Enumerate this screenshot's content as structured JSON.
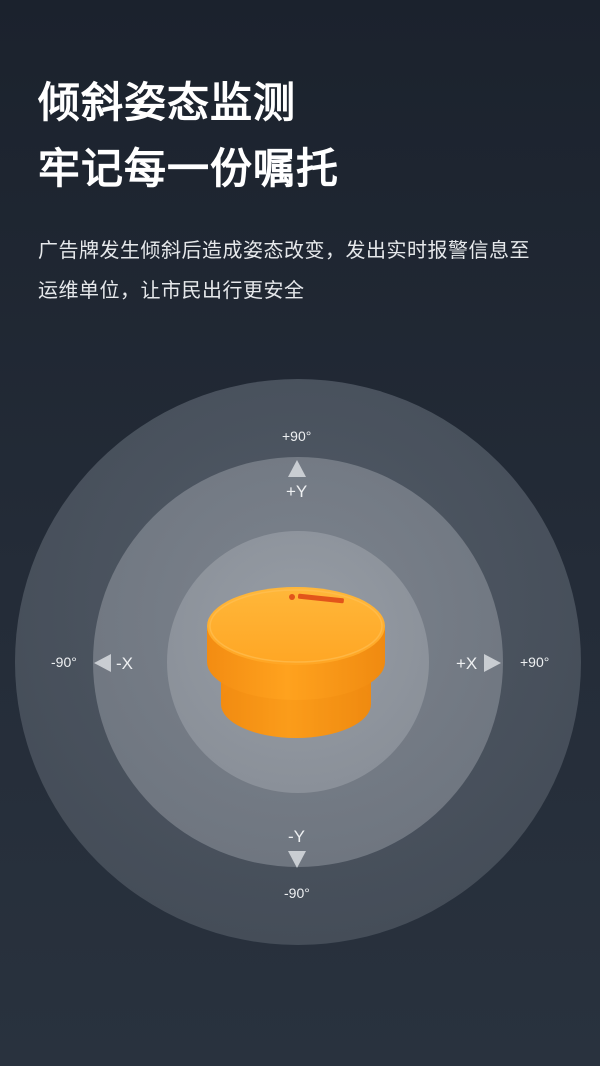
{
  "headline": {
    "line1": "倾斜姿态监测",
    "line2": "牢记每一份嘱托"
  },
  "description": {
    "line1": "广告牌发生倾斜后造成姿态改变，发出实时报警信息至",
    "line2": "运维单位，让市民出行更安全"
  },
  "diagram": {
    "y_positive_degree": "+90°",
    "y_positive_axis": "+Y",
    "y_negative_axis": "-Y",
    "y_negative_degree": "-90°",
    "x_negative_degree": "-90°",
    "x_negative_axis": "-X",
    "x_positive_axis": "+X",
    "x_positive_degree": "+90°"
  },
  "colors": {
    "background": "#1b222d",
    "device": "#ffa51f",
    "text": "#ffffff"
  },
  "icons": {
    "device": "tilt-sensor-device-image",
    "arrows": "direction-arrow-icon"
  }
}
